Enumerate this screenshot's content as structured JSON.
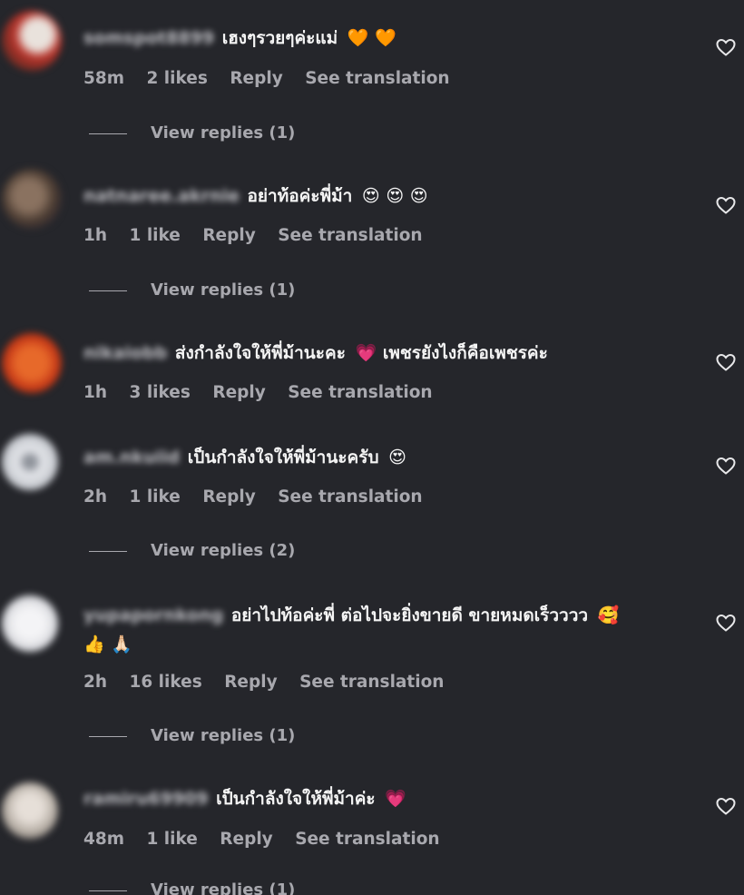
{
  "comments": [
    {
      "username": "somspot8899",
      "text": "เฮงๆรวยๆค่ะแม่",
      "emoji": "🧡 🧡",
      "time": "58m",
      "likes": "2 likes",
      "reply": "Reply",
      "translate": "See translation",
      "view_replies": "View replies (1)",
      "avatar_color": "#b8332a"
    },
    {
      "username": "natnaree.akrnie",
      "text": "อย่าท้อค่ะพี่ม้า",
      "emoji": "😍 😍 😍",
      "time": "1h",
      "likes": "1 like",
      "reply": "Reply",
      "translate": "See translation",
      "view_replies": "View replies (1)",
      "avatar_color": "#6b5a4a"
    },
    {
      "username": "nikaiobb",
      "text": "ส่งกำลังใจให้พี่ม้านะคะ",
      "emoji": "💗",
      "text2": "เพชรยังไงก็คือเพชรค่ะ",
      "time": "1h",
      "likes": "3 likes",
      "reply": "Reply",
      "translate": "See translation",
      "view_replies": "",
      "avatar_color": "#d2461a"
    },
    {
      "username": "am.nkuiid",
      "text": "เป็นกำลังใจให้พี่ม้านะครับ",
      "emoji": "😍",
      "time": "2h",
      "likes": "1 like",
      "reply": "Reply",
      "translate": "See translation",
      "view_replies": "View replies (2)",
      "avatar_color": "#b9bcc2"
    },
    {
      "username": "yupapornkong",
      "text": "อย่าไปท้อค่ะพี่ ต่อไปจะยิ่งขายดี ขายหมดเร็วววว",
      "emoji": "🥰",
      "emoji_line2": "👍 🙏🏻",
      "time": "2h",
      "likes": "16 likes",
      "reply": "Reply",
      "translate": "See translation",
      "view_replies": "View replies (1)",
      "avatar_color": "#d6d7db"
    },
    {
      "username": "ramiru69909",
      "text": "เป็นกำลังใจให้พี่ม้าค่ะ",
      "emoji": "💗",
      "time": "48m",
      "likes": "1 like",
      "reply": "Reply",
      "translate": "See translation",
      "view_replies": "View replies (1)",
      "avatar_color": "#c9c4be"
    }
  ]
}
